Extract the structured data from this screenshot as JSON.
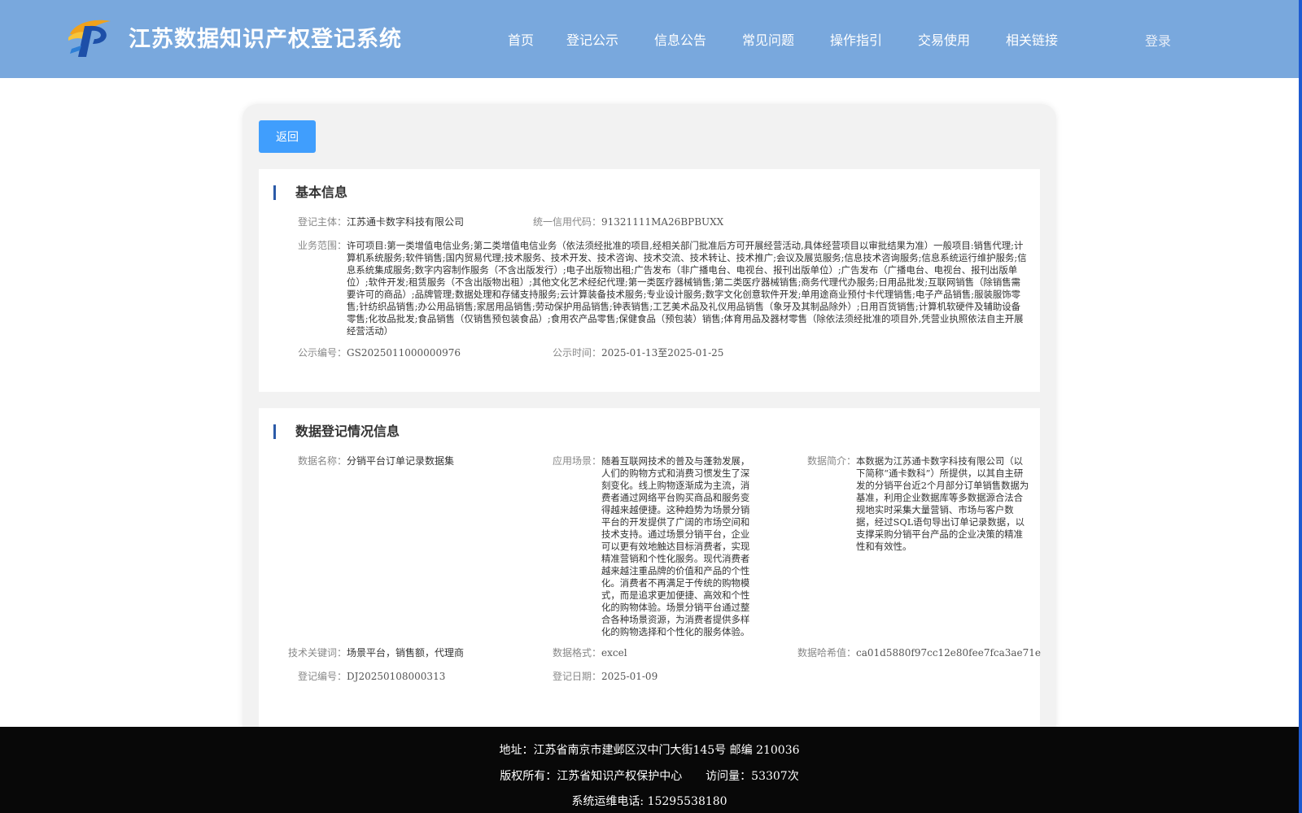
{
  "header": {
    "title": "江苏数据知识产权登记系统",
    "logo_icon": "cp-logo-icon",
    "nav": [
      "首页",
      "登记公示",
      "信息公告",
      "常见问题",
      "操作指引",
      "交易使用",
      "相关链接"
    ],
    "login": "登录"
  },
  "main": {
    "back_label": "返回",
    "basic": {
      "title": "基本信息",
      "subject_label": "登记主体：",
      "subject": "江苏通卡数字科技有限公司",
      "credit_label": "统一信用代码：",
      "credit": "91321111MA26BPBUXX",
      "scope_label": "业务范围：",
      "scope": "许可项目:第一类增值电信业务;第二类增值电信业务（依法须经批准的项目,经相关部门批准后方可开展经营活动,具体经营项目以审批结果为准）一般项目:销售代理;计算机系统服务;软件销售;国内贸易代理;技术服务、技术开发、技术咨询、技术交流、技术转让、技术推广;会议及展览服务;信息技术咨询服务;信息系统运行维护服务;信息系统集成服务;数字内容制作服务（不含出版发行）;电子出版物出租;广告发布（非广播电台、电视台、报刊出版单位）;广告发布（广播电台、电视台、报刊出版单位）;软件开发;租赁服务（不含出版物出租）;其他文化艺术经纪代理;第一类医疗器械销售;第二类医疗器械销售;商务代理代办服务;日用品批发;互联网销售（除销售需要许可的商品）;品牌管理;数据处理和存储支持服务;云计算装备技术服务;专业设计服务;数字文化创意软件开发;单用途商业预付卡代理销售;电子产品销售;服装服饰零售;针纺织品销售;办公用品销售;家居用品销售;劳动保护用品销售;钟表销售;工艺美术品及礼仪用品销售（象牙及其制品除外）;日用百货销售;计算机软硬件及辅助设备零售;化妆品批发;食品销售（仅销售预包装食品）;食用农产品零售;保健食品（预包装）销售;体育用品及器材零售（除依法须经批准的项目外,凭营业执照依法自主开展经营活动）",
      "pub_no_label": "公示编号：",
      "pub_no": "GS2025011000000976",
      "pub_time_label": "公示时间：",
      "pub_time": "2025-01-13至2025-01-25"
    },
    "data_info": {
      "title": "数据登记情况信息",
      "name_label": "数据名称：",
      "name": "分销平台订单记录数据集",
      "scene_label": "应用场景：",
      "scene": "随着互联网技术的普及与蓬勃发展，人们的购物方式和消费习惯发生了深刻变化。线上购物逐渐成为主流，消费者通过网络平台购买商品和服务变得越来越便捷。这种趋势为场景分销平台的开发提供了广阔的市场空间和技术支持。通过场景分销平台，企业可以更有效地触达目标消费者，实现精准营销和个性化服务。现代消费者越来越注重品牌的价值和产品的个性化。消费者不再满足于传统的购物模式，而是追求更加便捷、高效和个性化的购物体验。场景分销平台通过整合各种场景资源，为消费者提供多样化的购物选择和个性化的服务体验。",
      "intro_label": "数据简介：",
      "intro": "本数据为江苏通卡数字科技有限公司（以下简称“通卡数科”）所提供，以其自主研发的分销平台近2个月部分订单销售数据为基准，利用企业数据库等多数据源合法合规地实时采集大量营销、市场与客户数据，经过SQL语句导出订单记录数据，以支撑采购分销平台产品的企业决策的精准性和有效性。",
      "keywords_label": "技术关键词：",
      "keywords": "场景平台，销售额，代理商",
      "format_label": "数据格式：",
      "format": "excel",
      "hash_label": "数据哈希值：",
      "hash": "ca01d5880f97cc12e80fee7fca3ae71e",
      "reg_no_label": "登记编号：",
      "reg_no": "DJ20250108000313",
      "reg_date_label": "登记日期：",
      "reg_date": "2025-01-09"
    }
  },
  "footer": {
    "address": "地址：江苏省南京市建邺区汉中门大街145号 邮编 210036",
    "copyright": "版权所有：江苏省知识产权保护中心",
    "visits": "访问量：53307次",
    "phone": "系统运维电话: 15295538180"
  },
  "colors": {
    "header_bg": "#79a8dd",
    "button_bg": "#409efd",
    "accent_bar": "#2b5aa8",
    "footer_bg": "#080808"
  }
}
